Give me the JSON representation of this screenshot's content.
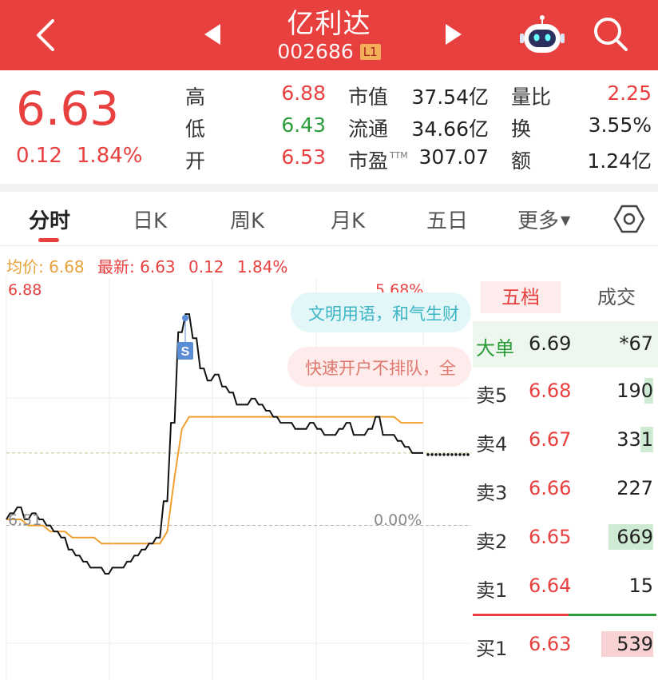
{
  "header": {
    "title": "亿利达",
    "code": "002686",
    "level_badge": "L1",
    "icons": [
      "back-arrow-icon",
      "prev-triangle-icon",
      "next-triangle-icon",
      "robot-assistant-icon",
      "search-icon"
    ]
  },
  "quote": {
    "price": "6.63",
    "change": "0.12",
    "change_pct": "1.84%",
    "rows": [
      {
        "l1": "高",
        "v1": "6.88",
        "l2": "市值",
        "v2": "37.54亿",
        "l3": "量比",
        "v3": "2.25"
      },
      {
        "l1": "低",
        "v1": "6.43",
        "l2": "流通",
        "v2": "34.66亿",
        "l3": "换",
        "v3": "3.55%"
      },
      {
        "l1": "开",
        "v1": "6.53",
        "l2": "市盈",
        "l2_sup": "TTM",
        "v2": "307.07",
        "l3": "额",
        "v3": "1.24亿"
      }
    ],
    "colors": {
      "up": "#e8403f",
      "down": "#2a9d3a"
    }
  },
  "tabs": {
    "items": [
      "分时",
      "日K",
      "周K",
      "月K",
      "五日",
      "更多"
    ],
    "active": "分时"
  },
  "info_line": {
    "avg_label": "均价:",
    "avg_value": "6.68",
    "latest_label": "最新:",
    "latest_value": "6.63",
    "latest_change": "0.12",
    "latest_pct": "1.84%"
  },
  "chart": {
    "y_top_label": "6.88",
    "y_base_label": "6.51",
    "pct_top_label": "5.68%",
    "pct_base_label": "0.00%",
    "marker_label": "S",
    "bubbles": [
      "文明用语，和气生财",
      "快速开户不排队，全"
    ]
  },
  "chart_data": {
    "type": "line",
    "ylim": [
      6.43,
      6.88
    ],
    "base_price": 6.51,
    "series": [
      {
        "name": "最新",
        "values": [
          6.52,
          6.53,
          6.54,
          6.52,
          6.53,
          6.52,
          6.51,
          6.5,
          6.49,
          6.47,
          6.46,
          6.45,
          6.44,
          6.44,
          6.43,
          6.44,
          6.44,
          6.45,
          6.46,
          6.47,
          6.48,
          6.49,
          6.55,
          6.68,
          6.83,
          6.86,
          6.82,
          6.77,
          6.75,
          6.76,
          6.74,
          6.73,
          6.71,
          6.71,
          6.72,
          6.71,
          6.7,
          6.69,
          6.68,
          6.68,
          6.67,
          6.67,
          6.68,
          6.67,
          6.66,
          6.66,
          6.67,
          6.68,
          6.66,
          6.66,
          6.67,
          6.69,
          6.66,
          6.66,
          6.65,
          6.64,
          6.63,
          6.63
        ]
      },
      {
        "name": "均价",
        "values": [
          6.52,
          6.52,
          6.52,
          6.51,
          6.51,
          6.51,
          6.5,
          6.5,
          6.5,
          6.49,
          6.49,
          6.49,
          6.49,
          6.48,
          6.48,
          6.48,
          6.48,
          6.48,
          6.48,
          6.48,
          6.48,
          6.48,
          6.5,
          6.59,
          6.67,
          6.69,
          6.69,
          6.69,
          6.69,
          6.69,
          6.69,
          6.69,
          6.69,
          6.69,
          6.69,
          6.69,
          6.69,
          6.69,
          6.69,
          6.69,
          6.69,
          6.69,
          6.69,
          6.69,
          6.69,
          6.69,
          6.69,
          6.69,
          6.69,
          6.69,
          6.69,
          6.69,
          6.69,
          6.69,
          6.68,
          6.68,
          6.68,
          6.68
        ]
      }
    ]
  },
  "order_book": {
    "tab_active": "五档",
    "tab_other": "成交",
    "big_order": {
      "label": "大单",
      "price": "6.69",
      "volume": "*67"
    },
    "asks": [
      {
        "label": "卖5",
        "price": "6.68",
        "volume": "190",
        "bar": 0.12
      },
      {
        "label": "卖4",
        "price": "6.67",
        "volume": "331",
        "bar": 0.18
      },
      {
        "label": "卖3",
        "price": "6.66",
        "volume": "227",
        "bar": 0.0
      },
      {
        "label": "卖2",
        "price": "6.65",
        "volume": "669",
        "bar": 0.62
      },
      {
        "label": "卖1",
        "price": "6.64",
        "volume": "15",
        "bar": 0.0
      }
    ],
    "bids": [
      {
        "label": "买1",
        "price": "6.63",
        "volume": "539",
        "bar": 0.5
      }
    ]
  }
}
